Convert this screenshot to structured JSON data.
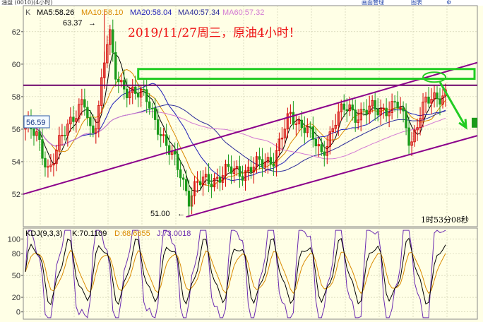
{
  "window": {
    "title_fragment": "油盘 (0010)(4小时)",
    "toolbar_labels": [
      "画面管理",
      "图表"
    ]
  },
  "colors": {
    "background": "#ffffe6",
    "grid": "#c9c9a8",
    "axis_text": "#333333",
    "ma5": "#000000",
    "ma10": "#d98a00",
    "ma20": "#1f1fb8",
    "ma40": "#2a2a99",
    "ma60": "#d37ad3",
    "candle_up": "#d40000",
    "candle_down": "#1a9a1a",
    "channel": "#8b008b",
    "horizontal_line": "#6a006a",
    "annotation": "#22cc22",
    "title_red": "#ee1111",
    "kdj_k": "#000000",
    "kdj_d": "#d98a00",
    "kdj_j": "#6a2ab0"
  },
  "main_panel": {
    "indicator_prefix": "K",
    "ma_legend": [
      {
        "label": "MA5:58.26",
        "color": "#000000"
      },
      {
        "label": "MA10:58.10",
        "color": "#d98a00"
      },
      {
        "label": "MA20:58.04",
        "color": "#1f1fb8"
      },
      {
        "label": "MA40:57.34",
        "color": "#2a2a99"
      },
      {
        "label": "MA60:57.32",
        "color": "#d37ad3"
      }
    ],
    "headline": "2019/11/27周三，原油4小时！",
    "high_label": "63.37",
    "low_label": "51.00",
    "price_tag": "56.59",
    "countdown": "1时53分08秒"
  },
  "kdj_panel": {
    "label": "KDJ(9,3,3)",
    "k_text": "K:70.1109",
    "d_text": "D:68.6655",
    "j_text": "J:73.0018"
  },
  "chart_data": [
    {
      "type": "candlestick",
      "ylim": [
        50,
        63.6
      ],
      "yticks": [
        52,
        54,
        56,
        58,
        60,
        62
      ],
      "grid": true,
      "annotations": {
        "high": 63.37,
        "low": 51.0,
        "horizontal_level": 58.7,
        "resistance_band": [
          59.1,
          59.7
        ],
        "last_price_tag": 56.59
      },
      "series": [
        {
          "name": "MA5",
          "value": 58.26
        },
        {
          "name": "MA10",
          "value": 58.1
        },
        {
          "name": "MA20",
          "value": 58.04
        },
        {
          "name": "MA40",
          "value": 57.34
        },
        {
          "name": "MA60",
          "value": 57.32
        }
      ]
    },
    {
      "type": "line",
      "ylim": [
        -10,
        115
      ],
      "yticks": [
        0,
        20,
        50,
        80,
        100
      ],
      "series": [
        {
          "name": "K",
          "value": 70.1109
        },
        {
          "name": "D",
          "value": 68.6655
        },
        {
          "name": "J",
          "value": 73.0018
        }
      ]
    }
  ]
}
